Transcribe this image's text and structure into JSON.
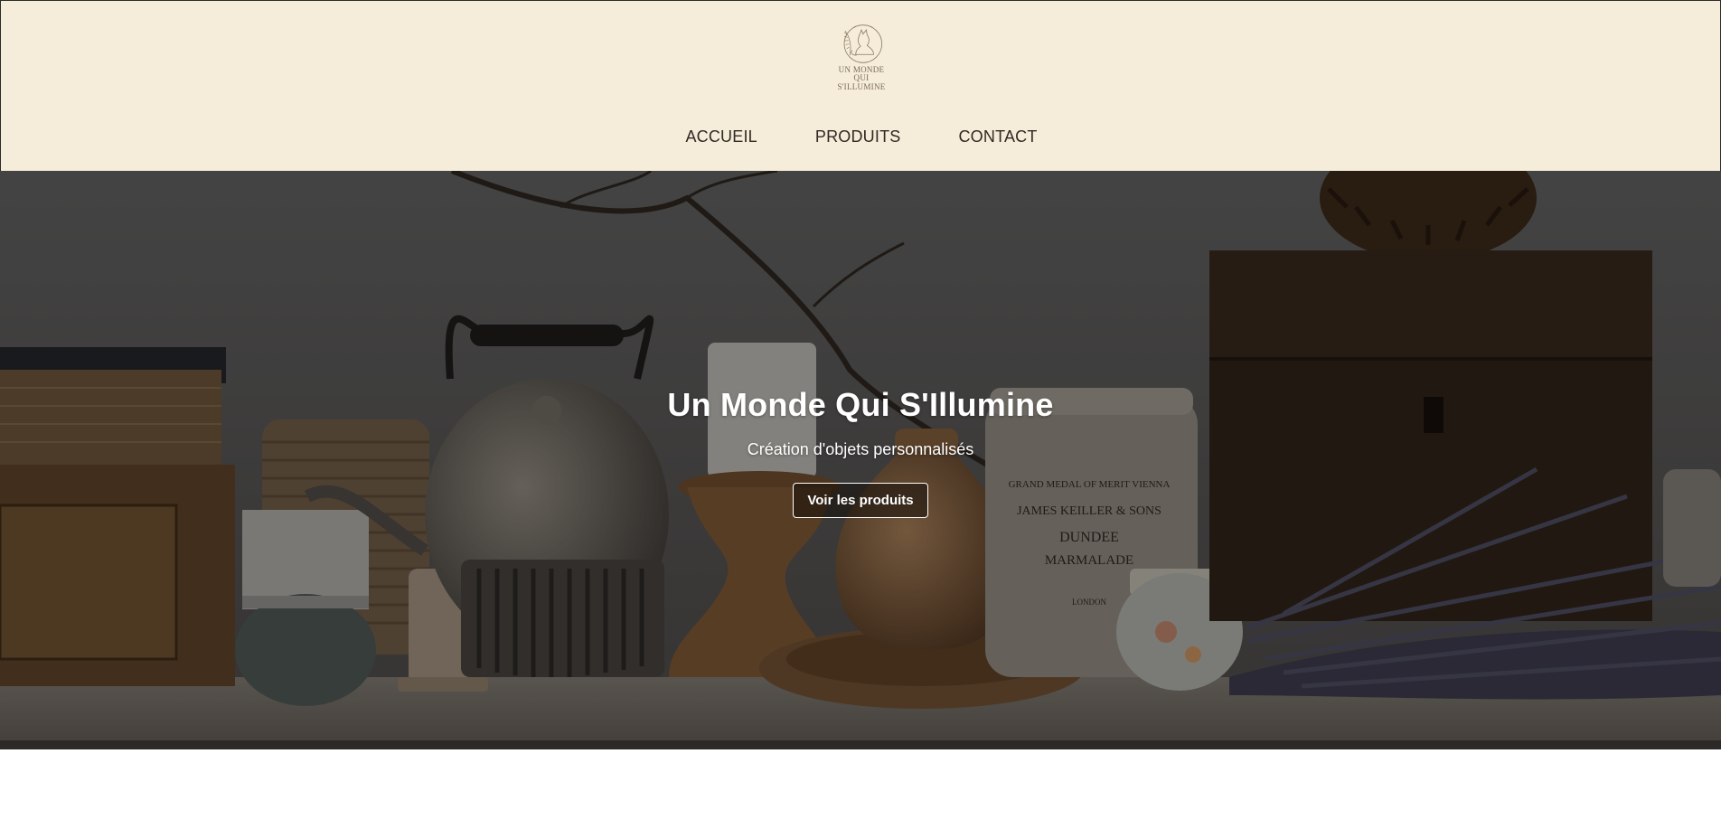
{
  "header": {
    "logo_text_line1": "UN MONDE QUI",
    "logo_text_line2": "S'ILLUMINE",
    "nav": [
      {
        "label": "ACCUEIL"
      },
      {
        "label": "PRODUITS"
      },
      {
        "label": "CONTACT"
      }
    ]
  },
  "hero": {
    "title": "Un Monde Qui S'Illumine",
    "subtitle": "Création d'objets personnalisés",
    "button_label": "Voir les produits",
    "jar_label_line1": "GRAND MEDAL OF MERIT VIENNA",
    "jar_label_line2": "JAMES KEILLER & SONS",
    "jar_label_line3": "DUNDEE",
    "jar_label_line4": "MARMALADE",
    "jar_label_line5": "LONDON"
  },
  "colors": {
    "header_bg": "#f5ecd9",
    "nav_text": "#2f2a25",
    "hero_text": "#ffffff"
  }
}
